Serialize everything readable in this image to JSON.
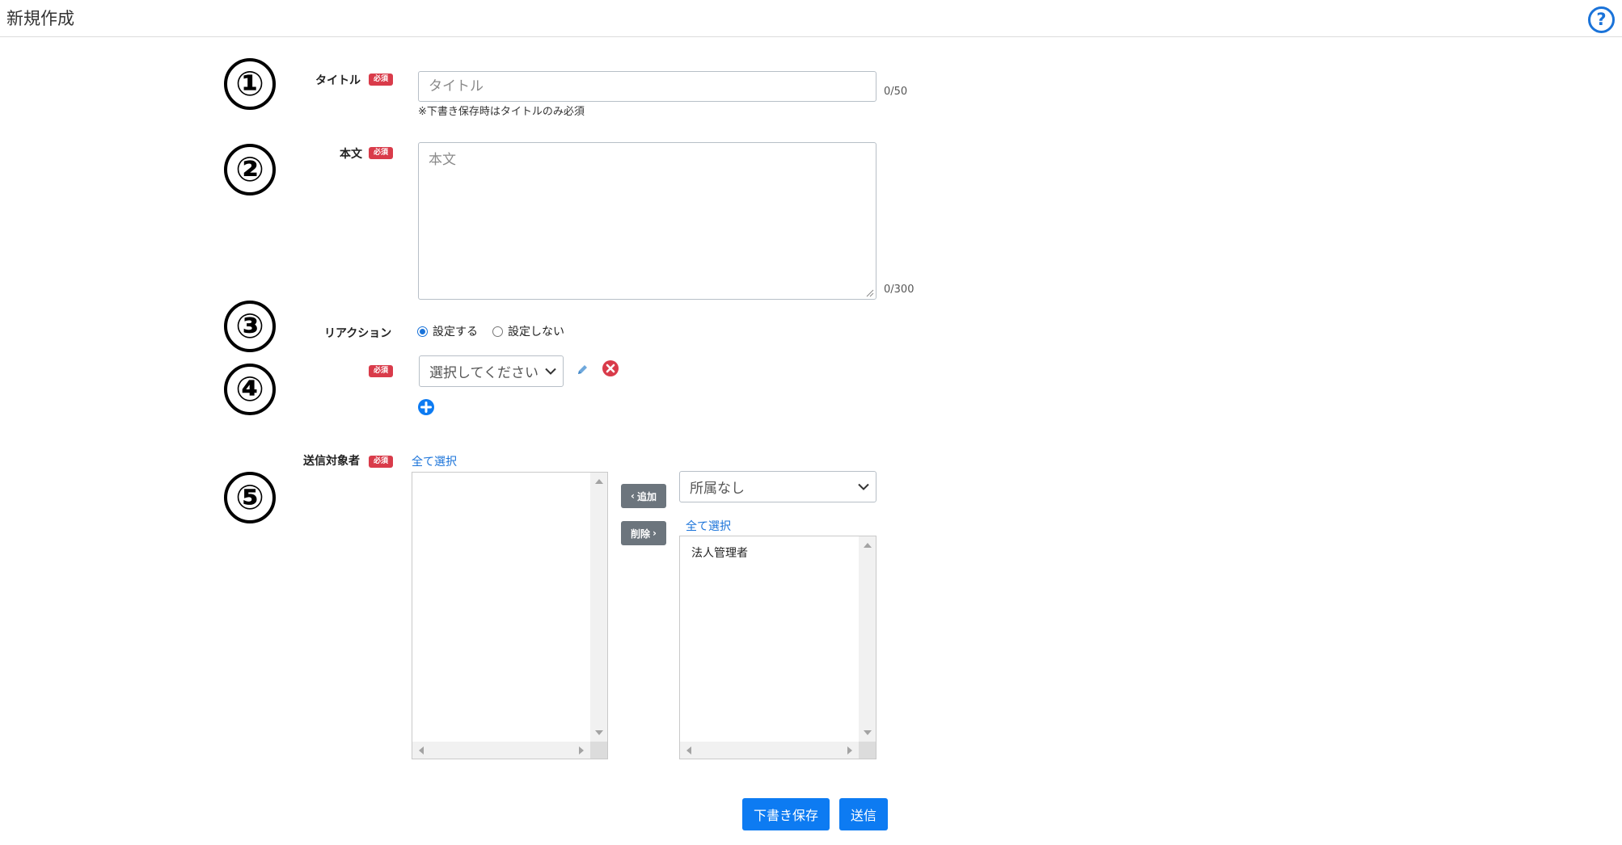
{
  "header": {
    "title": "新規作成",
    "help_icon": "question-circle-icon"
  },
  "markers": [
    "①",
    "②",
    "③",
    "④",
    "⑤"
  ],
  "form": {
    "required_badge": "必須",
    "title": {
      "label": "タイトル",
      "placeholder": "タイトル",
      "value": "",
      "counter": "0/50",
      "note": "※下書き保存時はタイトルのみ必須"
    },
    "body": {
      "label": "本文",
      "placeholder": "本文",
      "value": "",
      "counter": "0/300"
    },
    "reaction": {
      "label": "リアクション",
      "options": [
        "設定する",
        "設定しない"
      ],
      "selected": "設定する"
    },
    "reaction_select": {
      "value": "選択してください",
      "edit_icon": "pencil-icon",
      "remove_icon": "remove-circle-icon",
      "add_icon": "plus-circle-icon"
    },
    "recipients": {
      "label": "送信対象者",
      "select_all_left": "全て選択",
      "add_label": "追加",
      "remove_label": "削除",
      "group_select": "所属なし",
      "select_all_right": "全て選択",
      "right_items": [
        "法人管理者"
      ]
    }
  },
  "actions": {
    "draft_label": "下書き保存",
    "send_label": "送信"
  },
  "colors": {
    "primary": "#0d7bf2",
    "required": "#d93b4a",
    "secondary": "#6c757d",
    "link": "#1a73d9"
  }
}
